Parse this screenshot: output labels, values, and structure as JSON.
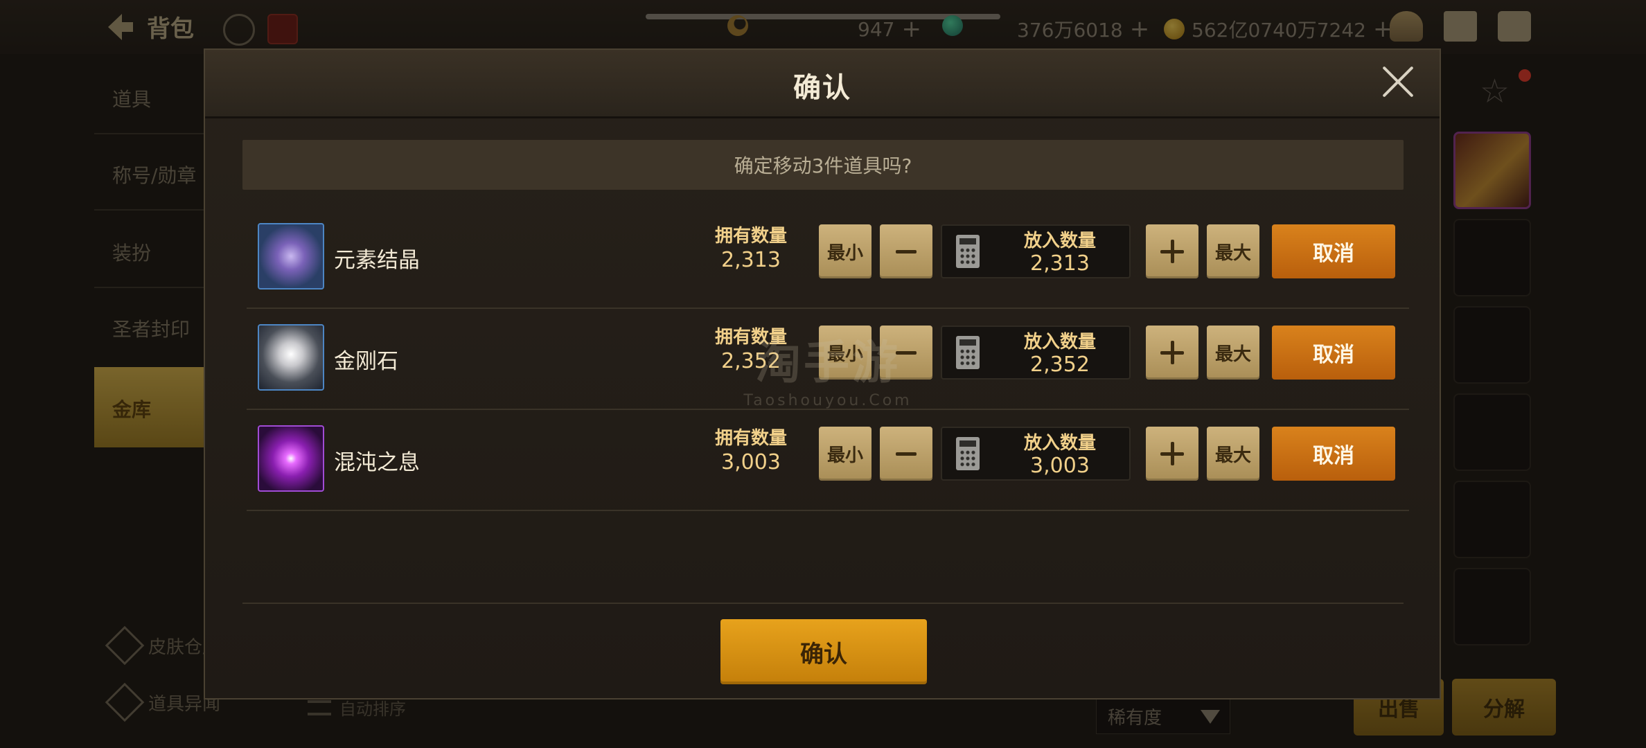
{
  "background": {
    "back_title": "背包",
    "currencies": [
      {
        "value": "947",
        "icon": "moon-coin-icon"
      },
      {
        "value": "376万6018",
        "icon": "gem-icon"
      },
      {
        "value": "562亿0740万7242",
        "icon": "gold-coin-icon"
      }
    ],
    "nav_items": [
      "道具",
      "称号/勋章",
      "装扮",
      "圣者封印"
    ],
    "nav_selected": "金库",
    "bottom_links": [
      "皮肤仓库",
      "道具异闻"
    ],
    "sort_label": "自动排序",
    "rarity_dropdown": "稀有度",
    "sell_label": "出售",
    "disassemble_label": "分解"
  },
  "dialog": {
    "title": "确认",
    "prompt": "确定移动3件道具吗?",
    "owned_label": "拥有数量",
    "put_label": "放入数量",
    "min_label": "最小",
    "max_label": "最大",
    "cancel_label": "取消",
    "confirm_label": "确认",
    "items": [
      {
        "name": "元素结晶",
        "owned": "2,313",
        "put": "2,313",
        "icon": "element-crystal-icon"
      },
      {
        "name": "金刚石",
        "owned": "2,352",
        "put": "2,352",
        "icon": "diamond-gem-icon"
      },
      {
        "name": "混沌之息",
        "owned": "3,003",
        "put": "3,003",
        "icon": "chaos-breath-icon"
      }
    ]
  },
  "watermark": {
    "main": "淘手游",
    "sub": "Taoshouyou.Com"
  },
  "colors": {
    "accent_gold": "#f1d08a",
    "cancel_orange": "#c96d12",
    "confirm_gold": "#d89212",
    "button_tan": "#bca06a"
  }
}
